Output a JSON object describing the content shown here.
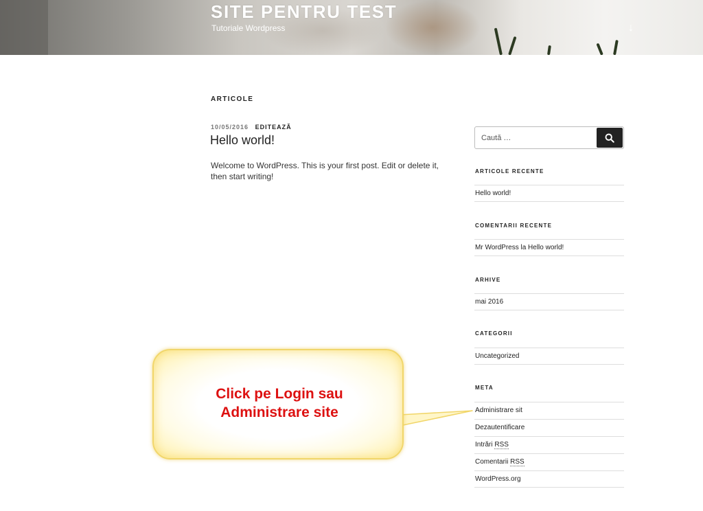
{
  "header": {
    "site_title": "SITE PENTRU TEST",
    "site_description": "Tutoriale Wordpress",
    "scroll_icon": "arrow-down-icon",
    "scroll_glyph": "↓"
  },
  "main": {
    "page_heading": "ARTICOLE",
    "post": {
      "date": "10/05/2016",
      "edit_label": "EDITEAZĂ",
      "title": "Hello world!",
      "excerpt": "Welcome to WordPress. This is your first post. Edit or delete it, then start writing!"
    }
  },
  "sidebar": {
    "search": {
      "placeholder": "Caută …",
      "button_icon": "search-icon"
    },
    "recent_posts": {
      "title": "ARTICOLE RECENTE",
      "items": [
        "Hello world!"
      ]
    },
    "recent_comments": {
      "title": "COMENTARII RECENTE",
      "items": [
        "Mr WordPress la Hello world!"
      ]
    },
    "archives": {
      "title": "ARHIVE",
      "items": [
        "mai 2016"
      ]
    },
    "categories": {
      "title": "CATEGORII",
      "items": [
        "Uncategorized"
      ]
    },
    "meta": {
      "title": "META",
      "items": [
        {
          "prefix": "Administrare sit",
          "abbr": "",
          "suffix": ""
        },
        {
          "prefix": "Dezautentificare",
          "abbr": "",
          "suffix": ""
        },
        {
          "prefix": "Intrări ",
          "abbr": "RSS",
          "suffix": ""
        },
        {
          "prefix": "Comentarii ",
          "abbr": "RSS",
          "suffix": ""
        },
        {
          "prefix": "WordPress.org",
          "abbr": "",
          "suffix": ""
        }
      ]
    }
  },
  "callout": {
    "line1": "Click pe Login sau",
    "line2": "Administrare site",
    "text_color": "#dd1111",
    "fill_color": "#fff6c8",
    "border_color": "#f1d66a"
  },
  "colors": {
    "text": "#222222",
    "muted": "#767676",
    "button": "#222222",
    "divider": "#dddddd"
  }
}
